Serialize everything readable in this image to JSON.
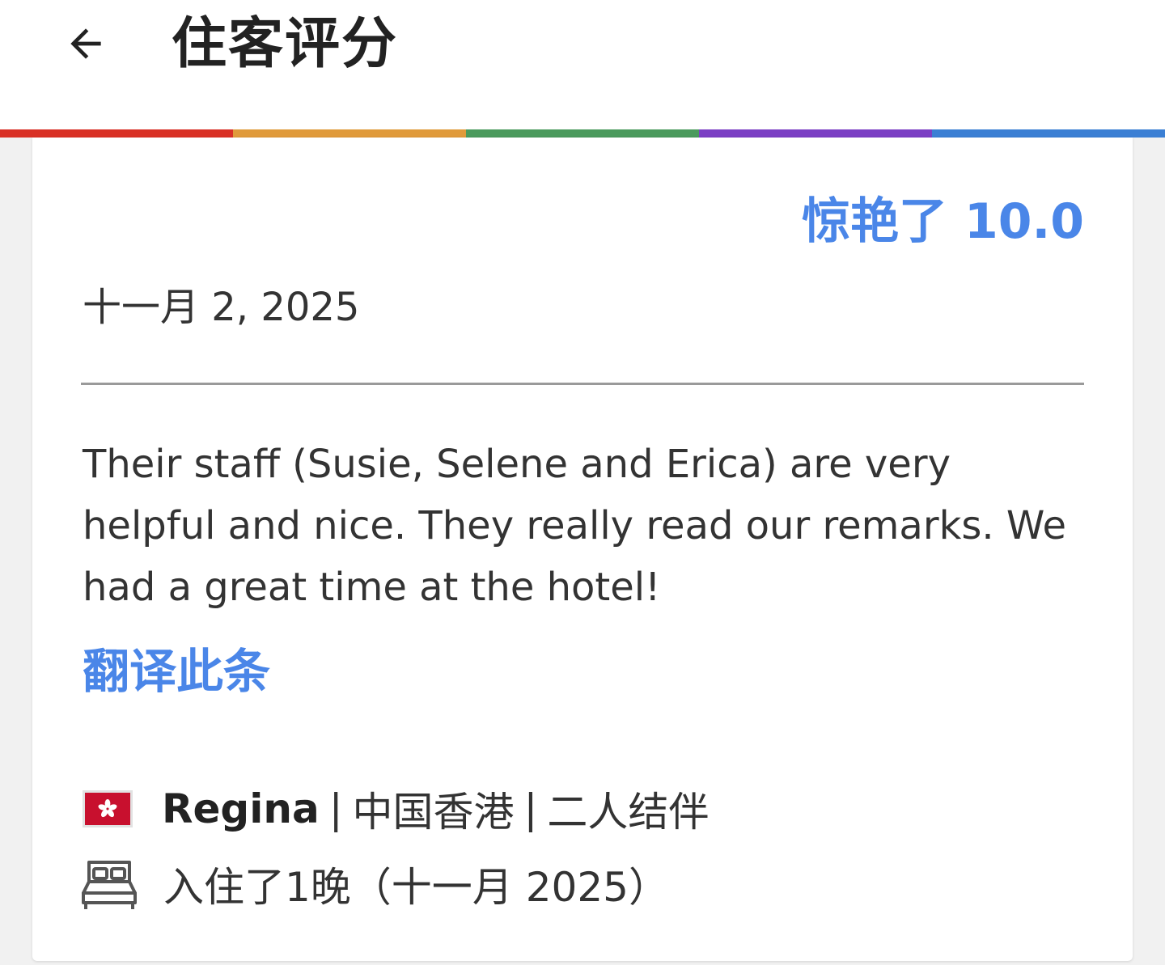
{
  "header": {
    "title": "住客评分"
  },
  "rainbow_colors": [
    "#d93025",
    "#e09a3a",
    "#4a9a5c",
    "#7b3fc4",
    "#3b7fd4"
  ],
  "review": {
    "score_label": "惊艳了 10.0",
    "date": "十一月 2, 2025",
    "text": "Their staff (Susie, Selene and Erica) are very helpful and nice. They really read our remarks. We had a great time at the hotel!",
    "translate_label": "翻译此条"
  },
  "reviewer": {
    "flag_icon": "hong-kong-flag-icon",
    "name": "Regina",
    "separator": "|",
    "region": "中国香港",
    "traveler_type": "二人结伴"
  },
  "stay": {
    "icon": "bed-icon",
    "text": "入住了1晚（十一月 2025）"
  },
  "colors": {
    "accent": "#4a86e8",
    "text_primary": "#222222",
    "text_body": "#333333",
    "background": "#f1f1f1"
  }
}
